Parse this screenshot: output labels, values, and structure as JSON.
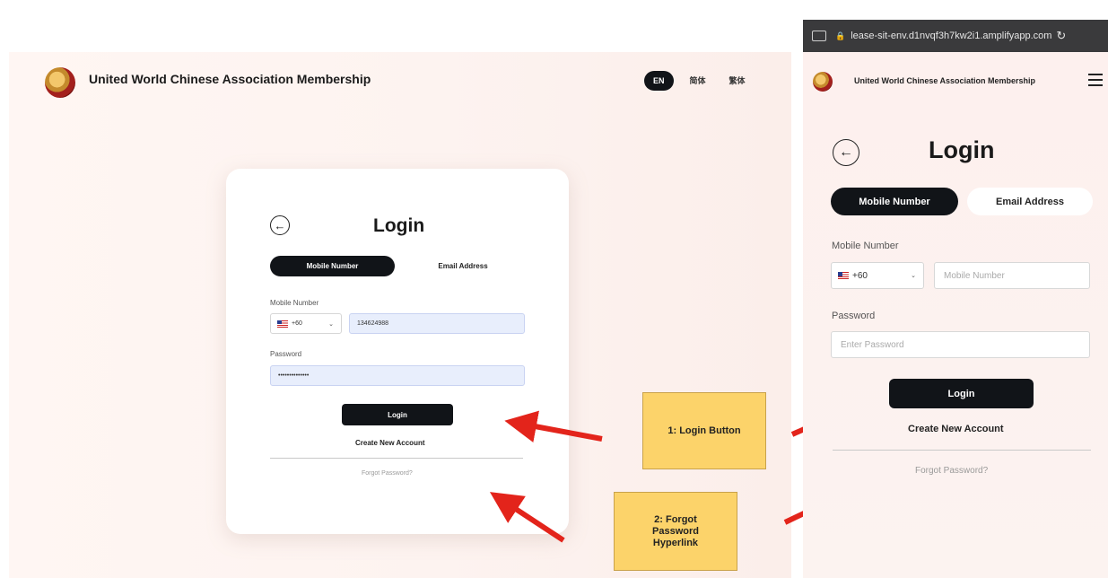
{
  "desktop": {
    "site_title": "United World Chinese Association Membership",
    "languages": [
      "EN",
      "简体",
      "繁体"
    ],
    "login": {
      "title": "Login",
      "tab_mobile": "Mobile Number",
      "tab_email": "Email Address",
      "mobile_label": "Mobile Number",
      "country_code": "+60",
      "mobile_value": "134624988",
      "password_label": "Password",
      "password_value": "••••••••••••••",
      "login_button": "Login",
      "create_account": "Create New Account",
      "forgot_password": "Forgot Password?"
    }
  },
  "callouts": {
    "login_button": "1: Login Button",
    "forgot_line1": "2: Forgot",
    "forgot_line2": "Password",
    "forgot_line3": "Hyperlink"
  },
  "mobile": {
    "url": "lease-sit-env.d1nvqf3h7kw2i1.amplifyapp.com",
    "site_title": "United World Chinese Association Membership",
    "login": {
      "title": "Login",
      "tab_mobile": "Mobile Number",
      "tab_email": "Email Address",
      "mobile_label": "Mobile Number",
      "country_code": "+60",
      "mobile_placeholder": "Mobile Number",
      "password_label": "Password",
      "password_placeholder": "Enter Password",
      "login_button": "Login",
      "create_account": "Create New Account",
      "forgot_password": "Forgot Password?"
    }
  },
  "colors": {
    "primary_dark": "#111418",
    "callout_yellow": "#fcd36a",
    "arrow_red": "#e3241b"
  },
  "icons": [
    "logo-icon",
    "back-arrow-icon",
    "flag-us-icon",
    "chevron-down-icon",
    "hamburger-menu-icon",
    "lock-icon",
    "reload-icon",
    "tabs-icon"
  ]
}
